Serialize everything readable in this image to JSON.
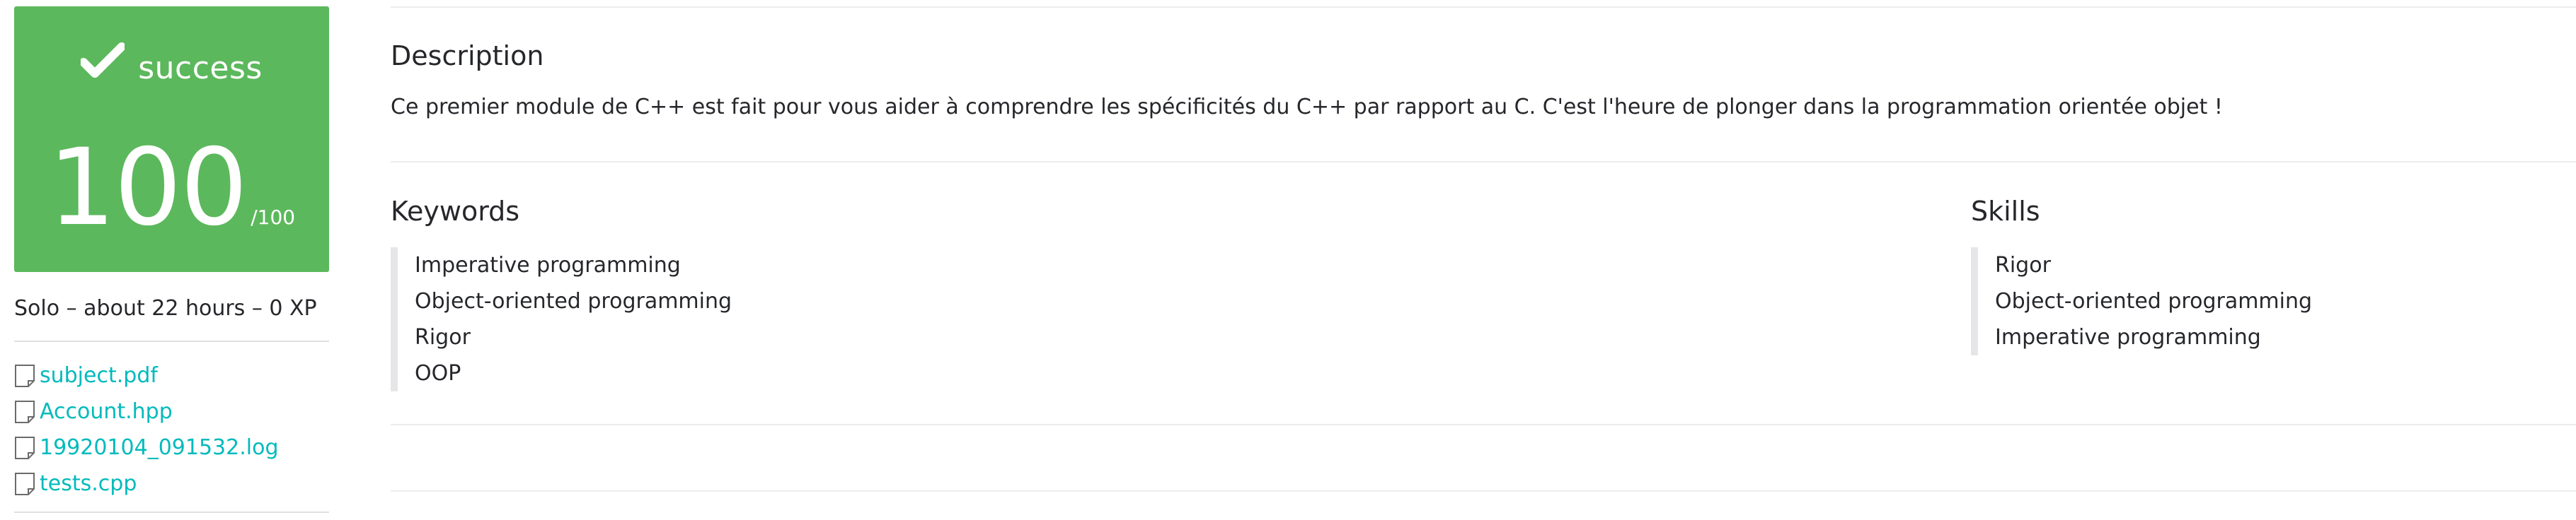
{
  "status": {
    "label": "success",
    "score": "100",
    "max": "/100",
    "color": "#5cb85c",
    "icon": "check-icon"
  },
  "project_meta": "Solo – about 22 hours – 0 XP",
  "files": [
    {
      "name": "subject.pdf",
      "icon": "file-icon"
    },
    {
      "name": "Account.hpp",
      "icon": "file-icon"
    },
    {
      "name": "19920104_091532.log",
      "icon": "file-icon"
    },
    {
      "name": "tests.cpp",
      "icon": "file-icon"
    }
  ],
  "link_color": "#00babc",
  "description": {
    "title": "Description",
    "text": "Ce premier module de C++ est fait pour vous aider à comprendre les spécificités du C++ par rapport au C. C'est l'heure de plonger dans la programmation orientée objet !"
  },
  "keywords": {
    "title": "Keywords",
    "items": [
      "Imperative programming",
      "Object-oriented programming",
      "Rigor",
      "OOP"
    ]
  },
  "skills": {
    "title": "Skills",
    "items": [
      "Rigor",
      "Object-oriented programming",
      "Imperative programming"
    ]
  }
}
